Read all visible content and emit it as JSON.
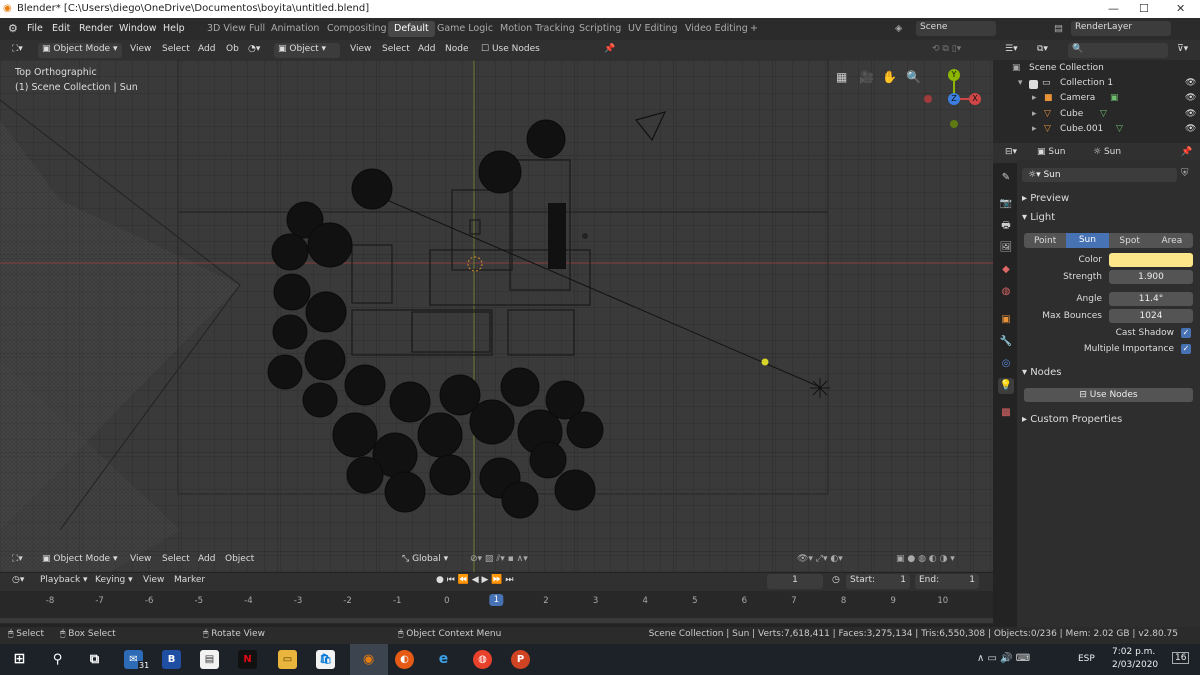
{
  "window": {
    "title": "Blender* [C:\\Users\\diego\\OneDrive\\Documentos\\boyita\\untitled.blend]"
  },
  "menubar": {
    "menus": [
      "File",
      "Edit",
      "Render",
      "Window",
      "Help"
    ],
    "workspaces": [
      "3D View Full",
      "Animation",
      "Compositing",
      "Default",
      "Game Logic",
      "Motion Tracking",
      "Scripting",
      "UV Editing",
      "Video Editing"
    ],
    "active_workspace": "Default",
    "scene": "Scene",
    "view_layer": "RenderLayer"
  },
  "viewport_header": {
    "mode": "Object Mode",
    "menus": [
      "View",
      "Select",
      "Add",
      "Ob"
    ],
    "second_mode": "Object",
    "second_menus": [
      "View",
      "Select",
      "Add",
      "Node"
    ],
    "use_nodes": "Use Nodes"
  },
  "viewport": {
    "view_name": "Top Orthographic",
    "collection_info": "(1) Scene Collection | Sun",
    "bottom_mode": "Object Mode",
    "bottom_menus": [
      "View",
      "Select",
      "Add",
      "Object"
    ],
    "transform_orientation": "Global",
    "gizmo_axes": {
      "x": "X",
      "y": "Y",
      "z": "Z"
    }
  },
  "outliner": {
    "root": "Scene Collection",
    "items": [
      {
        "label": "Collection 1",
        "depth": 1
      },
      {
        "label": "Camera",
        "depth": 2
      },
      {
        "label": "Cube",
        "depth": 2
      },
      {
        "label": "Cube.001",
        "depth": 2
      }
    ]
  },
  "properties": {
    "object_name": "Sun",
    "data_name": "Sun",
    "light_name": "Sun",
    "sections": {
      "preview": "Preview",
      "light": "Light",
      "nodes": "Nodes",
      "custom": "Custom Properties"
    },
    "light_types": [
      "Point",
      "Sun",
      "Spot",
      "Area"
    ],
    "active_light_type": "Sun",
    "fields": {
      "color_label": "Color",
      "color_value": "#fde68a",
      "strength_label": "Strength",
      "strength_value": "1.900",
      "angle_label": "Angle",
      "angle_value": "11.4°",
      "bounces_label": "Max Bounces",
      "bounces_value": "1024",
      "cast_shadow_label": "Cast Shadow",
      "multiple_importance_label": "Multiple Importance"
    },
    "use_nodes_button": "Use Nodes"
  },
  "timeline": {
    "menus": [
      "Playback",
      "Keying",
      "View",
      "Marker"
    ],
    "current_frame": "1",
    "start_label": "Start:",
    "start_value": "1",
    "end_label": "End:",
    "end_value": "1",
    "ruler": [
      "-8",
      "-7",
      "-6",
      "-5",
      "-4",
      "-3",
      "-2",
      "-1",
      "0",
      "1",
      "2",
      "3",
      "4",
      "5",
      "6",
      "7",
      "8",
      "9",
      "10"
    ]
  },
  "statusbar": {
    "select": "Select",
    "box_select": "Box Select",
    "rotate_view": "Rotate View",
    "context_menu": "Object Context Menu",
    "stats": "Scene Collection | Sun | Verts:7,618,411 | Faces:3,275,134 | Tris:6,550,308 | Objects:0/236 | Mem: 2.02 GB | v2.80.75"
  },
  "taskbar": {
    "mail_badge": "31",
    "language": "ESP",
    "time": "7:02 p.m.",
    "date": "2/03/2020",
    "notifications": "16"
  },
  "colors": {
    "accent": "#4772b3",
    "light_color": "#fde68a",
    "axis_x": "#d04646",
    "axis_y": "#8cb600",
    "axis_z": "#3b7fe0"
  }
}
